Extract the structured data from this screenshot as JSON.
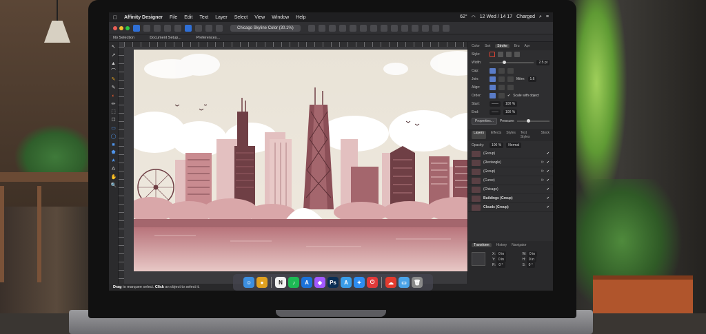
{
  "menubar": {
    "apple": "",
    "app_name": "Affinity Designer",
    "items": [
      "File",
      "Edit",
      "Text",
      "Layer",
      "Select",
      "View",
      "Window",
      "Help"
    ],
    "status_temp": "62°",
    "status_clock": "12 Wed / 14 17",
    "status_battery": "Charged"
  },
  "toolbar": {
    "doc_title": "Chicago Skyline Color (30.1%)"
  },
  "context_bar": {
    "selection": "No Selection",
    "doc_setup": "Document Setup...",
    "prefs": "Preferences..."
  },
  "tools": [
    "↖",
    "↗",
    "▲",
    "⌒",
    "✎",
    "✎",
    "◐",
    "✏",
    "⬚",
    "☐",
    "▭",
    "◯",
    "■",
    "⬟",
    "★",
    "A",
    "✋",
    "🔍"
  ],
  "panel": {
    "tabs": [
      "Color",
      "Swt",
      "Stroke",
      "Bru",
      "Apr"
    ],
    "active_tab": "Stroke",
    "style_label": "Style:",
    "width_label": "Width:",
    "width_value": "2.5 pt",
    "cap_label": "Cap:",
    "join_label": "Join:",
    "mitre_label": "Mitre:",
    "mitre_value": "1.6",
    "align_label": "Align:",
    "order_label": "Order:",
    "scale_label": "Scale with object",
    "start_label": "Start:",
    "start_value": "100 %",
    "end_label": "End:",
    "end_value": "100 %",
    "properties_button": "Properties...",
    "pressure_label": "Pressure:",
    "layers_tabs": [
      "Layers",
      "Effects",
      "Styles",
      "Text Styles",
      "Stock"
    ],
    "opacity_label": "Opacity:",
    "opacity_value": "100 %",
    "blend_value": "Normal",
    "layers": [
      {
        "name": "(Group)",
        "bold": false,
        "fx": false
      },
      {
        "name": "(Rectangle)",
        "bold": false,
        "fx": true
      },
      {
        "name": "(Group)",
        "bold": false,
        "fx": true
      },
      {
        "name": "(Curve)",
        "bold": false,
        "fx": true
      },
      {
        "name": "(Chicago)",
        "bold": false,
        "fx": false
      },
      {
        "name": "Buildings (Group)",
        "bold": true,
        "fx": false
      },
      {
        "name": "Clouds (Group)",
        "bold": true,
        "fx": false
      }
    ],
    "transform_tabs": [
      "Transform",
      "History",
      "Navigator"
    ],
    "transform": {
      "x_label": "X:",
      "x_value": "0 in",
      "w_label": "W:",
      "w_value": "0 in",
      "y_label": "Y:",
      "y_value": "0 in",
      "h_label": "H:",
      "h_value": "0 in",
      "r_label": "R:",
      "r_value": "0 °",
      "s_label": "S:",
      "s_value": "0 °"
    }
  },
  "statusbar": {
    "drag": "Drag",
    "drag_text": " to marquee select. ",
    "click": "Click",
    "click_text": " an object to select it."
  },
  "dock": [
    {
      "name": "finder",
      "glyph": "☺",
      "color": "#3d8fe0"
    },
    {
      "name": "chrome",
      "glyph": "●",
      "color": "#e0a020"
    },
    {
      "name": "notion",
      "glyph": "N",
      "color": "#f2f2f2"
    },
    {
      "name": "spotify",
      "glyph": "♪",
      "color": "#1db954"
    },
    {
      "name": "affinity-designer",
      "glyph": "A",
      "color": "#1b72d9"
    },
    {
      "name": "figma",
      "glyph": "◆",
      "color": "#a259ff"
    },
    {
      "name": "photoshop",
      "glyph": "Ps",
      "color": "#0a2e54"
    },
    {
      "name": "affinity-designer-2",
      "glyph": "A",
      "color": "#3a9de8"
    },
    {
      "name": "safari",
      "glyph": "✦",
      "color": "#2d8cf0"
    },
    {
      "name": "power",
      "glyph": "⏻",
      "color": "#e03a3a"
    },
    {
      "name": "creative-cloud",
      "glyph": "☁",
      "color": "#e23b2e"
    },
    {
      "name": "folder",
      "glyph": "▭",
      "color": "#4aa3e8"
    },
    {
      "name": "trash",
      "glyph": "🗑",
      "color": "#8a8a8a"
    }
  ],
  "colors": {
    "sky": "#e8e2d6",
    "cloud": "#ffffff",
    "building_dark": "#6f3f45",
    "building_mid": "#a4666d",
    "building_light": "#d7a7a8",
    "water": "#c98f93"
  }
}
